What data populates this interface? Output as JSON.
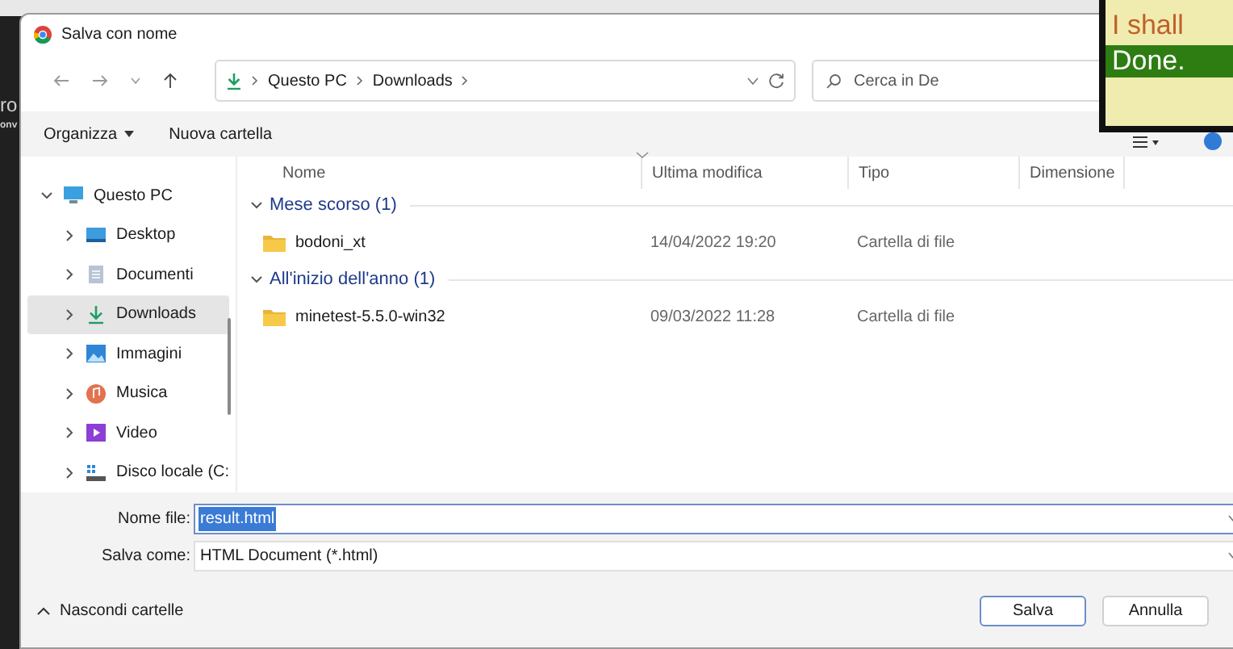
{
  "background": {
    "fragments": [
      "ro",
      "onv"
    ]
  },
  "overlay": {
    "lines": [
      {
        "text": "I shall",
        "kind": "plain"
      },
      {
        "text": "Done.",
        "kind": "highlight"
      }
    ]
  },
  "window": {
    "title": "Salva con nome"
  },
  "address": {
    "path": [
      "Questo PC",
      "Downloads"
    ],
    "search_placeholder": "Cerca in De"
  },
  "toolbar": {
    "organize": "Organizza",
    "new_folder": "Nuova cartella"
  },
  "sidebar": {
    "items": [
      {
        "label": "Questo PC",
        "kind": "pc",
        "expanded": true,
        "selected": false,
        "children": [
          {
            "label": "Desktop",
            "kind": "desktop",
            "expanded": false,
            "selected": false
          },
          {
            "label": "Documenti",
            "kind": "documents",
            "expanded": false,
            "selected": false
          },
          {
            "label": "Downloads",
            "kind": "downloads",
            "expanded": false,
            "selected": true
          },
          {
            "label": "Immagini",
            "kind": "pictures",
            "expanded": false,
            "selected": false
          },
          {
            "label": "Musica",
            "kind": "music",
            "expanded": false,
            "selected": false
          },
          {
            "label": "Video",
            "kind": "video",
            "expanded": false,
            "selected": false
          },
          {
            "label": "Disco locale (C:",
            "kind": "disk",
            "expanded": false,
            "selected": false
          }
        ]
      }
    ]
  },
  "table": {
    "columns": [
      "Nome",
      "Ultima modifica",
      "Tipo",
      "Dimensione"
    ],
    "groups": [
      {
        "title": "Mese scorso (1)",
        "expanded": true,
        "rows": [
          {
            "name": "bodoni_xt",
            "modified": "14/04/2022 19:20",
            "type": "Cartella di file"
          }
        ]
      },
      {
        "title": "All'inizio dell'anno (1)",
        "expanded": true,
        "rows": [
          {
            "name": "minetest-5.5.0-win32",
            "modified": "09/03/2022 11:28",
            "type": "Cartella di file"
          }
        ]
      }
    ]
  },
  "form": {
    "file_name_label": "Nome file:",
    "file_name": "result.html",
    "save_as_label": "Salva come:",
    "save_as": "HTML Document (*.html)"
  },
  "footer": {
    "hide_folders": "Nascondi cartelle",
    "buttons": [
      "Salva",
      "Annulla"
    ]
  }
}
